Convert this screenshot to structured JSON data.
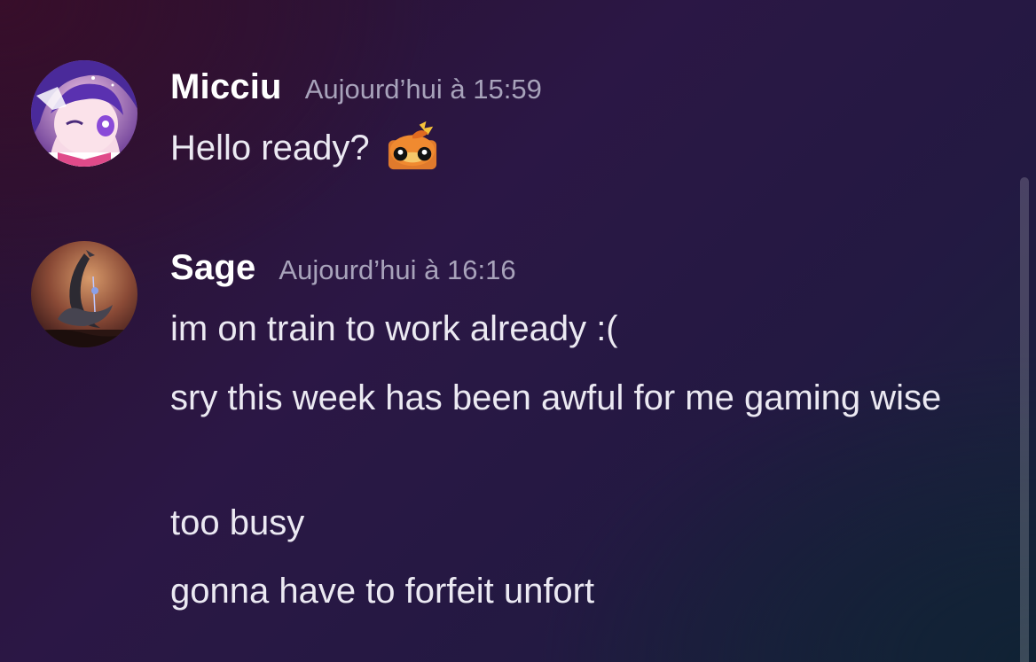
{
  "messages": [
    {
      "author": "Micciu",
      "timestamp": "Aujourd’hui à 15:59",
      "avatar_icon": "anime-girl-avatar",
      "lines": [
        "Hello ready?"
      ],
      "emoji_icon": "torchic-emoji"
    },
    {
      "author": "Sage",
      "timestamp": "Aujourd’hui à 16:16",
      "avatar_icon": "dark-moon-figure-avatar",
      "lines": [
        "im on train to work already :(",
        "sry this week has been awful for me gaming wise",
        "too busy",
        "gonna have to forfeit unfort"
      ]
    }
  ],
  "colors": {
    "username": "#ffffff",
    "timestamp": "#a8a3bb",
    "message_text": "#ebe9f2"
  }
}
